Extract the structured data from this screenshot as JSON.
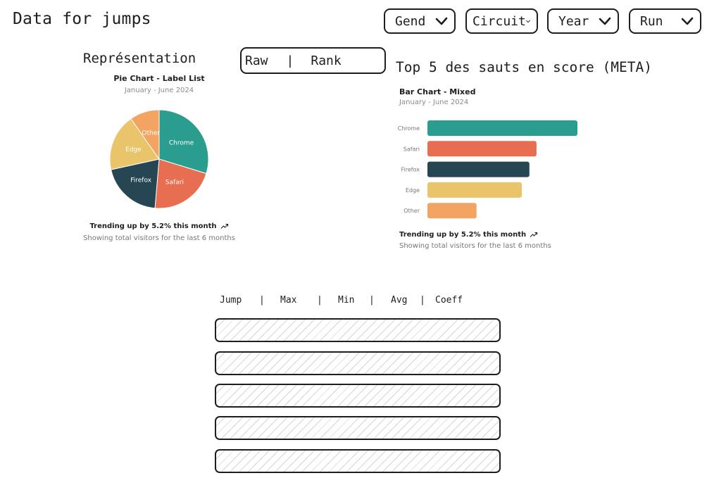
{
  "app": {
    "title": "Data for jumps"
  },
  "filters": [
    {
      "label": "Gend"
    },
    {
      "label": "Circuit"
    },
    {
      "label": "Year"
    },
    {
      "label": "Run"
    }
  ],
  "representation": {
    "title": "Représentation",
    "toggle": {
      "option_a": "Raw",
      "separator": "|",
      "option_b": "Rank"
    }
  },
  "top5": {
    "title": "Top 5 des sauts en score (META)"
  },
  "charts": {
    "pie": {
      "title": "Pie Chart - Label List",
      "subtitle": "January - June 2024",
      "trend": "Trending up by 5.2% this month",
      "footer": "Showing total visitors for the last 6 months"
    },
    "bar": {
      "title": "Bar Chart - Mixed",
      "subtitle": "January - June 2024",
      "trend": "Trending up by 5.2% this month",
      "footer": "Showing total visitors for the last 6 months"
    }
  },
  "colors": {
    "chrome": "#2a9d8f",
    "safari": "#e76e50",
    "firefox": "#264653",
    "edge": "#e9c46a",
    "other": "#f4a462"
  },
  "chart_data": [
    {
      "type": "pie",
      "title": "Pie Chart - Label List",
      "subtitle": "January - June 2024",
      "labels": [
        "Chrome",
        "Safari",
        "Firefox",
        "Edge",
        "Other"
      ],
      "values": [
        275,
        200,
        187,
        173,
        90
      ],
      "colors": [
        "#2a9d8f",
        "#e76e50",
        "#264653",
        "#e9c46a",
        "#f4a462"
      ]
    },
    {
      "type": "bar",
      "orientation": "horizontal",
      "title": "Bar Chart - Mixed",
      "subtitle": "January - June 2024",
      "categories": [
        "Chrome",
        "Safari",
        "Firefox",
        "Edge",
        "Other"
      ],
      "values": [
        275,
        200,
        187,
        173,
        90
      ],
      "colors": [
        "#2a9d8f",
        "#e76e50",
        "#264653",
        "#e9c46a",
        "#f4a462"
      ],
      "xlim": [
        0,
        275
      ]
    }
  ],
  "table": {
    "columns": [
      "Jump",
      "Max",
      "Min",
      "Avg",
      "Coeff"
    ],
    "separator": "|",
    "rows": 5
  },
  "icons": {
    "dropdown": "chevron-down-icon",
    "trend": "trending-up-icon"
  }
}
